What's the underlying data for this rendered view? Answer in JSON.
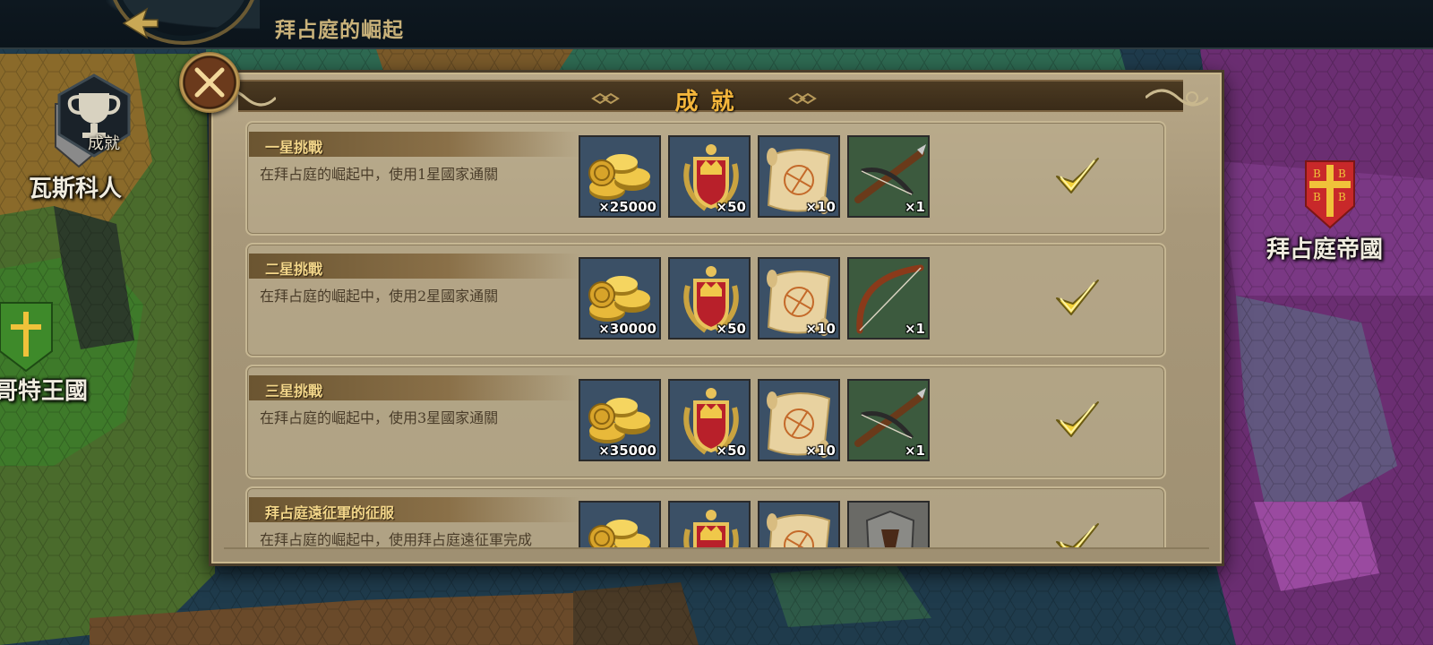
{
  "header": {
    "title": "拜占庭的崛起",
    "back_icon": "back-arrow-icon"
  },
  "map": {
    "nations": [
      {
        "id": "vyatichi",
        "label": "瓦斯科人"
      },
      {
        "id": "gothic",
        "label": "哥特王國"
      },
      {
        "id": "byzantine",
        "label": "拜占庭帝國"
      }
    ],
    "achievement_shortcut_label": "成就"
  },
  "dialog": {
    "title": "成就",
    "close_icon": "close-icon",
    "achievements": [
      {
        "title": "一星挑戰",
        "description": "在拜占庭的崛起中，使用1星國家通關",
        "completed": true,
        "rewards": [
          {
            "icon": "gold-coins-icon",
            "qty": "×25000"
          },
          {
            "icon": "medal-crest-icon",
            "qty": "×50"
          },
          {
            "icon": "scroll-map-icon",
            "qty": "×10"
          },
          {
            "icon": "crossbow-icon",
            "qty": "×1"
          }
        ]
      },
      {
        "title": "二星挑戰",
        "description": "在拜占庭的崛起中，使用2星國家通關",
        "completed": true,
        "rewards": [
          {
            "icon": "gold-coins-icon",
            "qty": "×30000"
          },
          {
            "icon": "medal-crest-icon",
            "qty": "×50"
          },
          {
            "icon": "scroll-map-icon",
            "qty": "×10"
          },
          {
            "icon": "bow-icon",
            "qty": "×1"
          }
        ]
      },
      {
        "title": "三星挑戰",
        "description": "在拜占庭的崛起中，使用3星國家通關",
        "completed": true,
        "rewards": [
          {
            "icon": "gold-coins-icon",
            "qty": "×35000"
          },
          {
            "icon": "medal-crest-icon",
            "qty": "×50"
          },
          {
            "icon": "scroll-map-icon",
            "qty": "×10"
          },
          {
            "icon": "crossbow-icon",
            "qty": "×1"
          }
        ]
      },
      {
        "title": "拜占庭遠征軍的征服",
        "description": "在拜占庭的崛起中，使用拜占庭遠征軍完成",
        "completed": true,
        "rewards": [
          {
            "icon": "gold-coins-icon",
            "qty": ""
          },
          {
            "icon": "medal-crest-icon",
            "qty": ""
          },
          {
            "icon": "scroll-map-icon",
            "qty": ""
          },
          {
            "icon": "armor-icon",
            "qty": ""
          }
        ]
      }
    ]
  },
  "colors": {
    "title_gold": "#f3b53b",
    "check_gold": "#f2d13a",
    "parchment": "#a8987a"
  }
}
